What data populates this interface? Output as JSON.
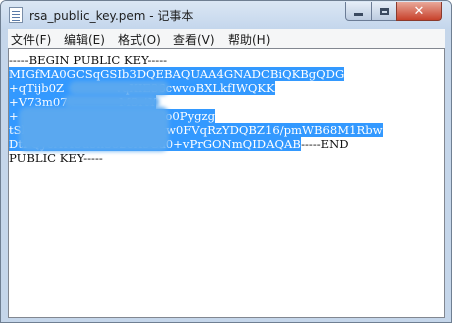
{
  "window": {
    "title": "rsa_public_key.pem - 记事本"
  },
  "titlebar_buttons": {
    "minimize_icon": "minimize-icon",
    "maximize_icon": "maximize-icon",
    "close_icon": "close-icon",
    "close_glyph": "✕"
  },
  "menu": {
    "items": [
      "文件(F)",
      "编辑(E)",
      "格式(O)",
      "查看(V)",
      "帮助(H)"
    ]
  },
  "editor": {
    "lines": [
      {
        "plain": "-----BEGIN PUBLIC KEY-----",
        "selected": "",
        "after": ""
      },
      {
        "plain": "",
        "selected": "MIGfMA0GCSqGSIb3DQEBAQUAA4GNADCBiQKBgQDG",
        "after": ""
      },
      {
        "plain": "",
        "selected": "+qTijb0Z              vqXIE36cwvoBXLkfIWQKK",
        "after": ""
      },
      {
        "plain": "",
        "selected": "+V73m07              M3rtY",
        "after": ""
      },
      {
        "plain": "",
        "selected": "+                       xBoj6Ve03o0Pygzg",
        "after": ""
      },
      {
        "plain": "",
        "selected": "tSk                      sbv04JOqw0FVqRzYDQBZ16/pmWB68M1Rbw",
        "after": ""
      },
      {
        "plain": "",
        "selected": "DtPQy0ATI3u3nS826X5Ga0+vPrGONmQIDAQAB",
        "after": "-----END"
      },
      {
        "plain": "PUBLIC KEY-----",
        "selected": "",
        "after": ""
      }
    ]
  },
  "colors": {
    "selection": "#3399ff",
    "close_button": "#c7412b"
  }
}
